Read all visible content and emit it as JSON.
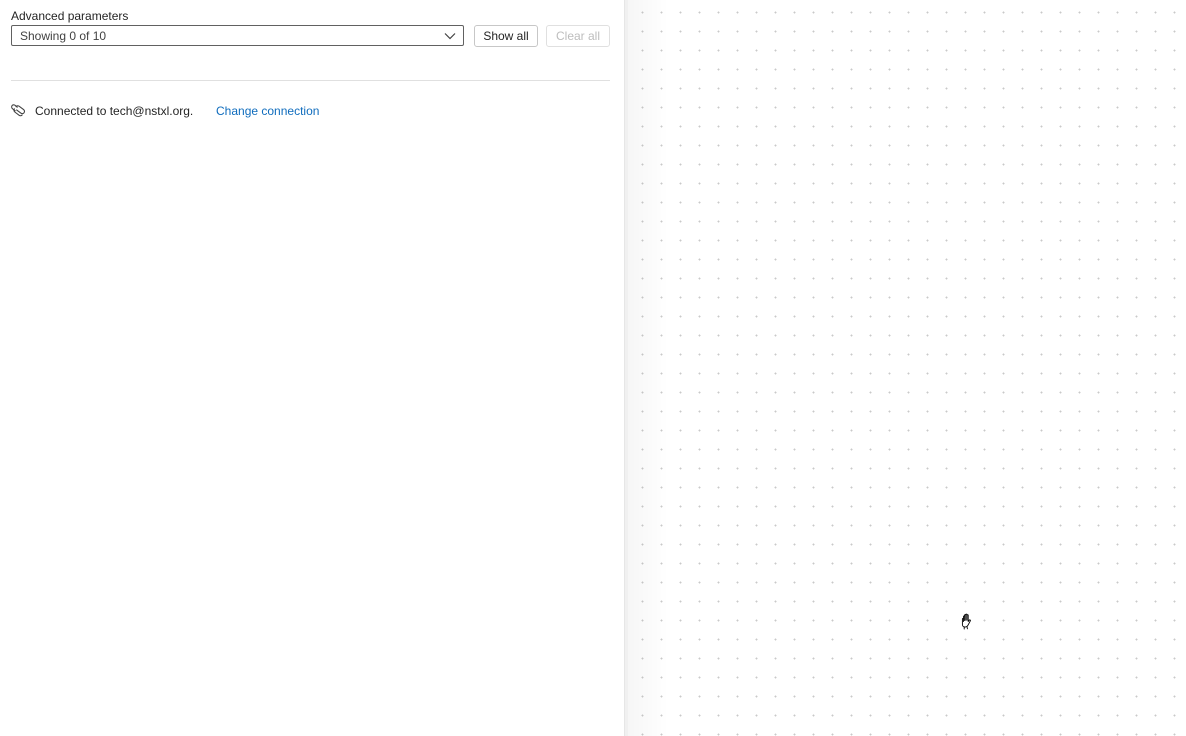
{
  "advanced": {
    "label": "Advanced parameters",
    "dropdown_value": "Showing 0 of 10",
    "show_all_label": "Show all",
    "clear_all_label": "Clear all"
  },
  "connection": {
    "icon": "connection-link-icon",
    "text": "Connected to tech@nstxl.org.",
    "change_label": "Change connection"
  },
  "canvas": {
    "cursor_icon": "hand-cursor-icon"
  },
  "colors": {
    "link": "#0f6cbd",
    "border": "#616161",
    "disabled_text": "#bdbdbd",
    "grid_dot": "#c9c9c9"
  }
}
